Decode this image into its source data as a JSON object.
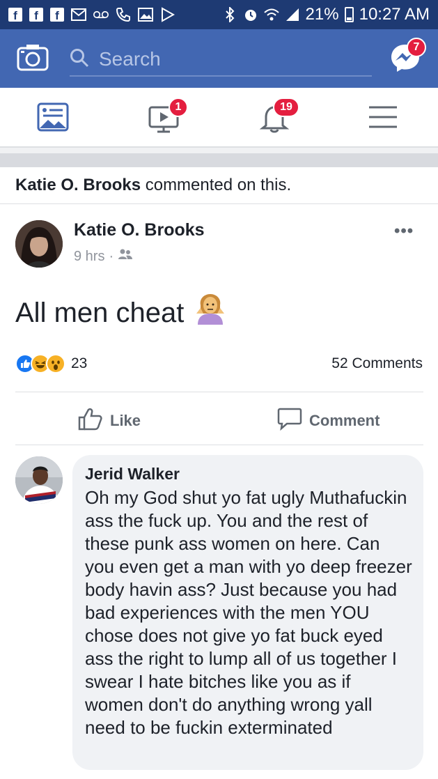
{
  "status_bar": {
    "battery": "21%",
    "time": "10:27 AM"
  },
  "header": {
    "search_placeholder": "Search",
    "messenger_badge": "7"
  },
  "tabs": {
    "video_badge": "1",
    "notifications_badge": "19"
  },
  "story": {
    "context_name": "Katie O. Brooks",
    "context_action": " commented on this."
  },
  "post": {
    "author": "Katie O. Brooks",
    "time": "9 hrs",
    "dot": "·",
    "more": "•••",
    "text": "All men cheat",
    "reaction_count": "23",
    "comments_count": "52 Comments",
    "like_label": "Like",
    "comment_label": "Comment"
  },
  "comment": {
    "author": "Jerid Walker",
    "text": "Oh my God shut yo fat ugly Muthafuckin ass the fuck up. You and the rest of these punk ass women on here. Can you even get a man with yo deep freezer body havin ass? Just because you had bad experiences with the men YOU chose does not give yo fat buck eyed ass the right to lump all of us together I swear I hate bitches like you as if women don't do anything wrong yall need to be fuckin exterminated"
  },
  "colors": {
    "status_bar": "#1e3a73",
    "brand": "#4267b2",
    "badge": "#e41e3f",
    "comment_bubble": "#f0f2f5"
  },
  "icons": [
    "camera-icon",
    "search-icon",
    "messenger-icon",
    "news-feed-icon",
    "video-icon",
    "notifications-icon",
    "menu-icon",
    "friends-icon",
    "like-reaction-icon",
    "haha-reaction-icon",
    "wow-reaction-icon",
    "like-icon",
    "comment-icon",
    "shrug-emoji-icon"
  ]
}
